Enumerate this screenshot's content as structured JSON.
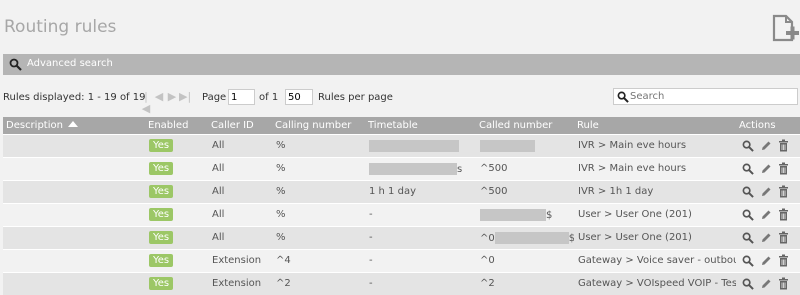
{
  "header": {
    "title": "Routing rules",
    "new_icon": "new-page-plus-icon"
  },
  "advanced_search": {
    "label": "Advanced search",
    "icon": "search-icon"
  },
  "pager": {
    "info": "Rules displayed: 1 - 19 of 19",
    "page_label": "Page",
    "page_value": "1",
    "of_label": "of 1",
    "per_page_value": "50",
    "per_page_label": "Rules per page"
  },
  "search": {
    "placeholder": "Search"
  },
  "table": {
    "columns": [
      "Description",
      "Enabled",
      "Caller ID",
      "Calling number",
      "Timetable",
      "Called number",
      "Rule",
      "Actions"
    ],
    "rows": [
      {
        "enabled": "Yes",
        "caller_id": "All",
        "calling": "%",
        "timetable": "",
        "called": "",
        "rule": "IVR > Main eve hours"
      },
      {
        "enabled": "Yes",
        "caller_id": "All",
        "calling": "%",
        "timetable": "s",
        "called": "^500",
        "rule": "IVR > Main eve hours"
      },
      {
        "enabled": "Yes",
        "caller_id": "All",
        "calling": "%",
        "timetable": "1 h 1 day",
        "called": "^500",
        "rule": "IVR > 1h 1 day"
      },
      {
        "enabled": "Yes",
        "caller_id": "All",
        "calling": "%",
        "timetable": "-",
        "called": "$",
        "rule": "User > User One (201)"
      },
      {
        "enabled": "Yes",
        "caller_id": "All",
        "calling": "%",
        "timetable": "-",
        "called": "^0",
        "called_suffix": "$",
        "rule": "User > User One (201)"
      },
      {
        "enabled": "Yes",
        "caller_id": "Extension",
        "calling": "^4",
        "timetable": "-",
        "called": "^0",
        "rule": "Gateway > Voice saver - outbound"
      },
      {
        "enabled": "Yes",
        "caller_id": "Extension",
        "calling": "^2",
        "timetable": "-",
        "called": "^2",
        "rule": "Gateway > VOIspeed VOIP - Test"
      }
    ]
  },
  "colors": {
    "header_bar": "#a7a7a7",
    "adv_bar": "#b5b5b5",
    "yes_badge": "#9cc766",
    "row_odd": "#e4e4e4",
    "row_even": "#f2f2f2"
  }
}
